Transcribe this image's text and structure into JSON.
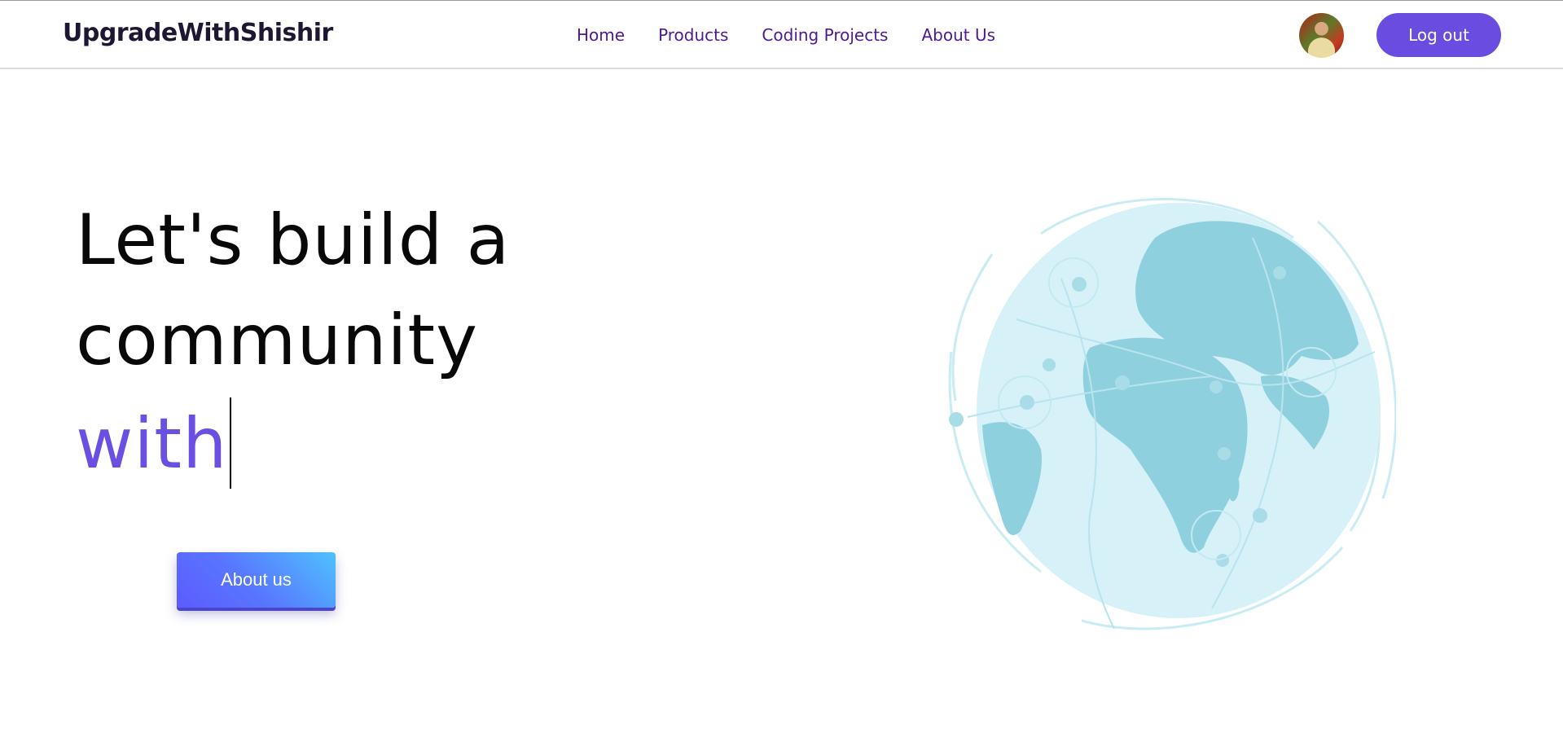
{
  "header": {
    "brand": "UpgradeWithShishir",
    "nav": [
      {
        "label": "Home"
      },
      {
        "label": "Products"
      },
      {
        "label": "Coding Projects"
      },
      {
        "label": "About Us"
      }
    ],
    "logout_label": "Log out"
  },
  "hero": {
    "line1": "Let's build a",
    "line2": "community",
    "line3": "with",
    "about_button": "About us"
  },
  "colors": {
    "accent": "#6a4ce0",
    "nav_text": "#4b1a91",
    "globe_light": "#d6f1f7",
    "globe_land": "#8fd0de"
  },
  "icons": {
    "avatar": "user-avatar",
    "globe": "globe-illustration"
  }
}
